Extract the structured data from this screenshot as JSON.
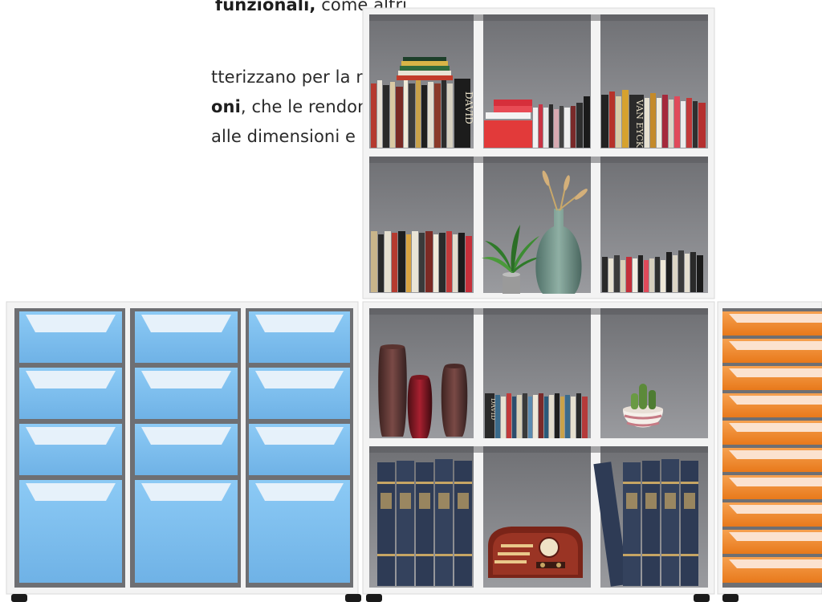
{
  "text": {
    "line1_bold": "funzionali,",
    "line1_rest": " come altri,",
    "line2": "tterizzano per la molte-",
    "line3_bold": "oni",
    "line3_rest": ", che le rendono",
    "line4": "alle dimensioni e neces-"
  },
  "book_spines": {
    "david_top": "DAVID",
    "van_eyck": "VAN EYCK",
    "david_mid": "DAVID"
  },
  "colors": {
    "shelf_white": "#f4f4f4",
    "cubby_back": "#8a8b8f",
    "tray_blue": "#7fc0ef",
    "tray_orange": "#f18a2b"
  }
}
